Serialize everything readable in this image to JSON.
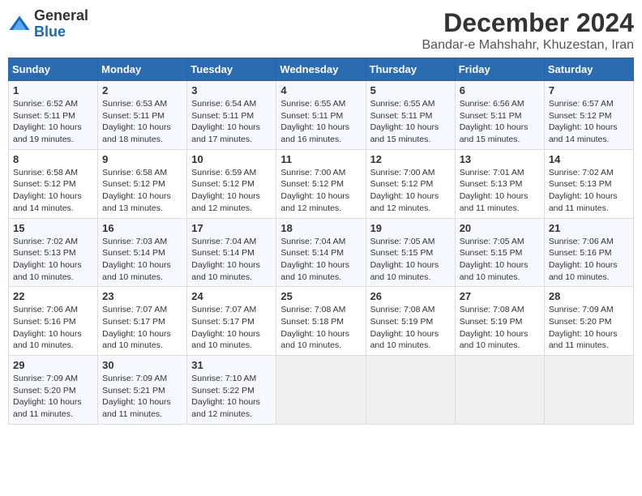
{
  "logo": {
    "general": "General",
    "blue": "Blue"
  },
  "header": {
    "month_year": "December 2024",
    "location": "Bandar-e Mahshahr, Khuzestan, Iran"
  },
  "days_of_week": [
    "Sunday",
    "Monday",
    "Tuesday",
    "Wednesday",
    "Thursday",
    "Friday",
    "Saturday"
  ],
  "weeks": [
    [
      {
        "day": "1",
        "sunrise": "6:52 AM",
        "sunset": "5:11 PM",
        "daylight": "10 hours and 19 minutes."
      },
      {
        "day": "2",
        "sunrise": "6:53 AM",
        "sunset": "5:11 PM",
        "daylight": "10 hours and 18 minutes."
      },
      {
        "day": "3",
        "sunrise": "6:54 AM",
        "sunset": "5:11 PM",
        "daylight": "10 hours and 17 minutes."
      },
      {
        "day": "4",
        "sunrise": "6:55 AM",
        "sunset": "5:11 PM",
        "daylight": "10 hours and 16 minutes."
      },
      {
        "day": "5",
        "sunrise": "6:55 AM",
        "sunset": "5:11 PM",
        "daylight": "10 hours and 15 minutes."
      },
      {
        "day": "6",
        "sunrise": "6:56 AM",
        "sunset": "5:11 PM",
        "daylight": "10 hours and 15 minutes."
      },
      {
        "day": "7",
        "sunrise": "6:57 AM",
        "sunset": "5:12 PM",
        "daylight": "10 hours and 14 minutes."
      }
    ],
    [
      {
        "day": "8",
        "sunrise": "6:58 AM",
        "sunset": "5:12 PM",
        "daylight": "10 hours and 14 minutes."
      },
      {
        "day": "9",
        "sunrise": "6:58 AM",
        "sunset": "5:12 PM",
        "daylight": "10 hours and 13 minutes."
      },
      {
        "day": "10",
        "sunrise": "6:59 AM",
        "sunset": "5:12 PM",
        "daylight": "10 hours and 12 minutes."
      },
      {
        "day": "11",
        "sunrise": "7:00 AM",
        "sunset": "5:12 PM",
        "daylight": "10 hours and 12 minutes."
      },
      {
        "day": "12",
        "sunrise": "7:00 AM",
        "sunset": "5:12 PM",
        "daylight": "10 hours and 12 minutes."
      },
      {
        "day": "13",
        "sunrise": "7:01 AM",
        "sunset": "5:13 PM",
        "daylight": "10 hours and 11 minutes."
      },
      {
        "day": "14",
        "sunrise": "7:02 AM",
        "sunset": "5:13 PM",
        "daylight": "10 hours and 11 minutes."
      }
    ],
    [
      {
        "day": "15",
        "sunrise": "7:02 AM",
        "sunset": "5:13 PM",
        "daylight": "10 hours and 10 minutes."
      },
      {
        "day": "16",
        "sunrise": "7:03 AM",
        "sunset": "5:14 PM",
        "daylight": "10 hours and 10 minutes."
      },
      {
        "day": "17",
        "sunrise": "7:04 AM",
        "sunset": "5:14 PM",
        "daylight": "10 hours and 10 minutes."
      },
      {
        "day": "18",
        "sunrise": "7:04 AM",
        "sunset": "5:14 PM",
        "daylight": "10 hours and 10 minutes."
      },
      {
        "day": "19",
        "sunrise": "7:05 AM",
        "sunset": "5:15 PM",
        "daylight": "10 hours and 10 minutes."
      },
      {
        "day": "20",
        "sunrise": "7:05 AM",
        "sunset": "5:15 PM",
        "daylight": "10 hours and 10 minutes."
      },
      {
        "day": "21",
        "sunrise": "7:06 AM",
        "sunset": "5:16 PM",
        "daylight": "10 hours and 10 minutes."
      }
    ],
    [
      {
        "day": "22",
        "sunrise": "7:06 AM",
        "sunset": "5:16 PM",
        "daylight": "10 hours and 10 minutes."
      },
      {
        "day": "23",
        "sunrise": "7:07 AM",
        "sunset": "5:17 PM",
        "daylight": "10 hours and 10 minutes."
      },
      {
        "day": "24",
        "sunrise": "7:07 AM",
        "sunset": "5:17 PM",
        "daylight": "10 hours and 10 minutes."
      },
      {
        "day": "25",
        "sunrise": "7:08 AM",
        "sunset": "5:18 PM",
        "daylight": "10 hours and 10 minutes."
      },
      {
        "day": "26",
        "sunrise": "7:08 AM",
        "sunset": "5:19 PM",
        "daylight": "10 hours and 10 minutes."
      },
      {
        "day": "27",
        "sunrise": "7:08 AM",
        "sunset": "5:19 PM",
        "daylight": "10 hours and 10 minutes."
      },
      {
        "day": "28",
        "sunrise": "7:09 AM",
        "sunset": "5:20 PM",
        "daylight": "10 hours and 11 minutes."
      }
    ],
    [
      {
        "day": "29",
        "sunrise": "7:09 AM",
        "sunset": "5:20 PM",
        "daylight": "10 hours and 11 minutes."
      },
      {
        "day": "30",
        "sunrise": "7:09 AM",
        "sunset": "5:21 PM",
        "daylight": "10 hours and 11 minutes."
      },
      {
        "day": "31",
        "sunrise": "7:10 AM",
        "sunset": "5:22 PM",
        "daylight": "10 hours and 12 minutes."
      },
      null,
      null,
      null,
      null
    ]
  ]
}
